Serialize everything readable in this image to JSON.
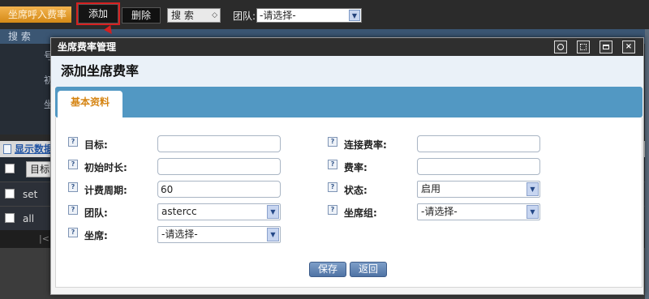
{
  "toolbar": {
    "tab_label": "坐席呼入费率",
    "add_label": "添加",
    "delete_label": "删除",
    "search_select": "搜 索",
    "team_label": "团队:",
    "team_select": "-请选择-"
  },
  "search": {
    "bar_label": "搜 索",
    "partial_labels": [
      "号",
      "初",
      "坐"
    ]
  },
  "list": {
    "show_data_label": "显示数据",
    "header_col": "目标",
    "rows": [
      {
        "text": "set"
      },
      {
        "text": "all"
      }
    ],
    "pager_glyph": "|<"
  },
  "modal": {
    "window_title": "坐席费率管理",
    "heading": "添加坐席费率",
    "tab_label": "基本资料",
    "help_glyph": "?",
    "fields": {
      "target": {
        "label": "目标:",
        "value": ""
      },
      "connect_rate": {
        "label": "连接费率:",
        "value": ""
      },
      "initial_duration": {
        "label": "初始时长:",
        "value": ""
      },
      "rate": {
        "label": "费率:",
        "value": ""
      },
      "billing_period": {
        "label": "计费周期:",
        "value": "60"
      },
      "status": {
        "label": "状态:",
        "value": "启用"
      },
      "team": {
        "label": "团队:",
        "value": "astercc"
      },
      "agent_group": {
        "label": "坐席组:",
        "value": "-请选择-"
      },
      "agent": {
        "label": "坐席:",
        "value": "-请选择-"
      }
    },
    "save_label": "保存",
    "back_label": "返回"
  },
  "icons": {
    "window_close": "×",
    "select_arrow": "▼",
    "spinner_arrow": "◇"
  },
  "colors": {
    "accent_orange": "#d58412",
    "tab_bar_blue": "#5298c3",
    "button_blue": "#4f73a5",
    "highlight_red": "#d62020"
  }
}
